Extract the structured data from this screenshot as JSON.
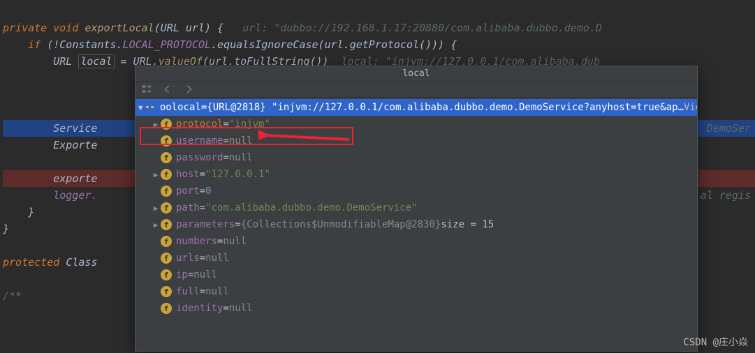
{
  "code": {
    "l1a": "private void ",
    "l1b": "exportLocal",
    "l1c": "(URL url) {   ",
    "l1d": "url: \"dubbo://192.168.1.17:20880/com.alibaba.dubbo.demo.D",
    "l2a": "    if ",
    "l2b": "(!Constants.",
    "l2c": "LOCAL_PROTOCOL",
    "l2d": ".equalsIgnoreCase(url.getProtocol())) {",
    "l3a": "        URL ",
    "l3b": "local",
    "l3c": " = URL.",
    "l3d": "valueOf",
    "l3e": "(url.toFullString())  ",
    "l3f": "local: \"injvm://127.0.0.1/com.alibaba.dub",
    "l7": "        Service",
    "l7b": "DemoSer",
    "l8": "        Exporte",
    "l10": "        exporte",
    "l11": "        logger.",
    "l11b": "al regis",
    "l12": "    }",
    "l13": "}",
    "l15": "protected ",
    "l15b": "Class",
    "l17": "/**"
  },
  "popup": {
    "title": "local",
    "root": {
      "pre": "oo ",
      "name": "local",
      "eq": " = ",
      "val": "{URL@2818} \"injvm://127.0.0.1/com.alibaba.dubbo.demo.DemoService?anyhost=true&ap…",
      "view": "View"
    },
    "fields": [
      {
        "arrow": true,
        "name": "protocol",
        "eq": " = ",
        "val": "\"injvm\"",
        "type": "str",
        "hl": true
      },
      {
        "name": "username",
        "eq": " = ",
        "val": "null",
        "type": "gray"
      },
      {
        "name": "password",
        "eq": " = ",
        "val": "null",
        "type": "gray"
      },
      {
        "arrow": true,
        "name": "host",
        "eq": " = ",
        "val": "\"127.0.0.1\"",
        "type": "str"
      },
      {
        "name": "port",
        "eq": " = ",
        "val": "0",
        "type": "num"
      },
      {
        "arrow": true,
        "name": "path",
        "eq": " = ",
        "val": "\"com.alibaba.dubbo.demo.DemoService\"",
        "type": "str"
      },
      {
        "arrow": true,
        "name": "parameters",
        "eq": " = ",
        "val": "{Collections$UnmodifiableMap@2830}",
        "type": "gray",
        "suffix": "  size = 15"
      },
      {
        "name": "numbers",
        "eq": " = ",
        "val": "null",
        "type": "gray"
      },
      {
        "name": "urls",
        "eq": " = ",
        "val": "null",
        "type": "gray"
      },
      {
        "name": "ip",
        "eq": " = ",
        "val": "null",
        "type": "gray"
      },
      {
        "name": "full",
        "eq": " = ",
        "val": "null",
        "type": "gray"
      },
      {
        "name": "identity",
        "eq": " = ",
        "val": "null",
        "type": "gray"
      }
    ]
  },
  "watermark": "CSDN @庄小焱"
}
